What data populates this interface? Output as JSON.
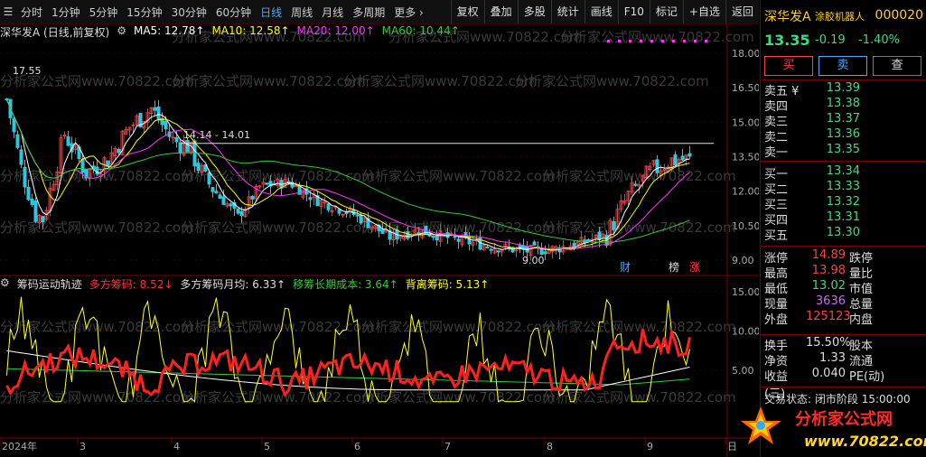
{
  "toolbar": {
    "periods": [
      "分时",
      "1分钟",
      "5分钟",
      "15分钟",
      "30分钟",
      "60分钟",
      "日线",
      "周线",
      "月线",
      "多周期",
      "更多 ›"
    ],
    "active_period": "日线",
    "actions": [
      "复权",
      "叠加",
      "多股",
      "统计",
      "画线",
      "F10",
      "标记",
      "+自选",
      "返回"
    ]
  },
  "main_legend": {
    "title": "深华发A (日线,前复权)",
    "ma5": "MA5: 12.78↑",
    "ma10": "MA10: 12.58↑",
    "ma20": "MA20: 12.00↑",
    "ma60": "MA60: 10.44↑"
  },
  "main_annotations": {
    "high_label": "17.55",
    "range_label": "14.14 - 14.01",
    "low_label": "9.00",
    "cai_badge": "财",
    "bang_badge": "榜",
    "zhang_badge": "涨"
  },
  "price_axis": [
    "18.00",
    "16.50",
    "15.00",
    "13.50",
    "12.00",
    "10.50",
    "9.00"
  ],
  "indicator_legend": {
    "name": "筹码运动轨迹",
    "dfcm": "多方筹码: 8.52↓",
    "dfcm_monthly": "多方筹码月均: 6.33↑",
    "ydcb": "移筹长期成本: 3.64↑",
    "blcm": "背离筹码: 5.13↑"
  },
  "indicator_axis": [
    "15.00",
    "10.00",
    "5.00"
  ],
  "time_axis": [
    "2024年",
    "3",
    "4",
    "5",
    "6",
    "7",
    "8",
    "9",
    "日"
  ],
  "watermark": "分析家公式网www.70822.com",
  "side": {
    "stock_name": "深华发A",
    "concept": "涂胶机器人",
    "code": "000020",
    "price": "13.35",
    "change": "-0.19",
    "change_pct": "-1.40%",
    "buy_label": "买",
    "sell_label": "卖",
    "query_label": "查",
    "asks": [
      {
        "label": "卖五 ¥",
        "price": "13.39"
      },
      {
        "label": "卖四",
        "price": "13.38"
      },
      {
        "label": "卖三",
        "price": "13.37"
      },
      {
        "label": "卖二",
        "price": "13.36"
      },
      {
        "label": "卖一",
        "price": "13.35"
      }
    ],
    "bids": [
      {
        "label": "买一",
        "price": "13.34"
      },
      {
        "label": "买二",
        "price": "13.33"
      },
      {
        "label": "买三",
        "price": "13.32"
      },
      {
        "label": "买四",
        "price": "13.31"
      },
      {
        "label": "买五",
        "price": "13.30"
      }
    ],
    "stats": [
      {
        "label": "涨停",
        "value": "14.89",
        "color": "#ff4040",
        "label2": "跌停"
      },
      {
        "label": "最高",
        "value": "13.98",
        "color": "#ff4040",
        "label2": "量比"
      },
      {
        "label": "最低",
        "value": "13.02",
        "color": "#3ddc84",
        "label2": "市值"
      },
      {
        "label": "现量",
        "value": "3636",
        "color": "#cc66ff",
        "label2": "总量"
      },
      {
        "label": "外盘",
        "value": "125123",
        "color": "#ff4040",
        "label2": "内盘"
      }
    ],
    "stats2": [
      {
        "label": "换手",
        "value": "15.50%",
        "label2": "股本"
      },
      {
        "label": "净资",
        "value": "1.33",
        "label2": "流通"
      },
      {
        "label": "收益(三)",
        "value": "0.040",
        "label2": "PE(动)"
      }
    ],
    "status_label": "交易状态:",
    "status_value": "闭市阶段 15:00:00"
  },
  "logo": {
    "title": "分析家公式网",
    "url": "www.70822.com"
  },
  "colors": {
    "up": "#ff3030",
    "down": "#28c8e0",
    "ma5": "#ffffff",
    "ma10": "#ffff00",
    "ma20": "#ff33ff",
    "ma60": "#33cc33"
  }
}
